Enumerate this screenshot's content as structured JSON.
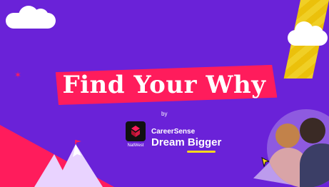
{
  "banner": {
    "headline": "Find Your Why",
    "by": "by",
    "brand": {
      "bank": "NatWest",
      "product": "CareerSense",
      "tagline": "Dream Bigger"
    }
  },
  "colors": {
    "background": "#6a22d8",
    "accent_pink": "#ff1c5c",
    "accent_yellow": "#f7d81c",
    "text": "#ffffff"
  },
  "icons": [
    "natwest-logo-icon",
    "cursor-icon",
    "cloud-icon",
    "mountain-icon",
    "star-icon"
  ]
}
